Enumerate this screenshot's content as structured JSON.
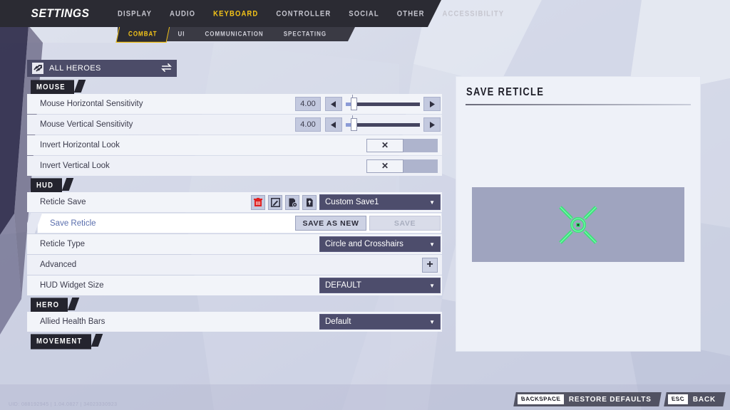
{
  "app": {
    "title": "SETTINGS"
  },
  "nav": {
    "tabs": [
      {
        "label": "DISPLAY",
        "active": false
      },
      {
        "label": "AUDIO",
        "active": false
      },
      {
        "label": "KEYBOARD",
        "active": true
      },
      {
        "label": "CONTROLLER",
        "active": false
      },
      {
        "label": "SOCIAL",
        "active": false
      },
      {
        "label": "OTHER",
        "active": false
      },
      {
        "label": "ACCESSIBILITY",
        "active": false
      }
    ],
    "subtabs": [
      {
        "label": "COMBAT",
        "active": true
      },
      {
        "label": "UI",
        "active": false
      },
      {
        "label": "COMMUNICATION",
        "active": false
      },
      {
        "label": "SPECTATING",
        "active": false
      }
    ]
  },
  "hero_selector": {
    "icon": "hero-roster-icon",
    "label": "ALL HEROES",
    "swap_icon": "swap-arrows-icon"
  },
  "sections": [
    {
      "title": "MOUSE",
      "rows": [
        {
          "label": "Mouse Horizontal Sensitivity",
          "control": "slider",
          "value": "4.00",
          "dec_icon": "left-arrow-icon",
          "inc_icon": "right-arrow-icon",
          "fill_percent": 8
        },
        {
          "label": "Mouse Vertical Sensitivity",
          "control": "slider",
          "value": "4.00",
          "dec_icon": "left-arrow-icon",
          "inc_icon": "right-arrow-icon",
          "fill_percent": 8
        },
        {
          "label": "Invert Horizontal Look",
          "control": "toggle",
          "value": "✕"
        },
        {
          "label": "Invert Vertical Look",
          "control": "toggle",
          "value": "✕"
        }
      ]
    },
    {
      "title": "HUD",
      "rows": [
        {
          "label": "Reticle Save",
          "control": "save-slot",
          "value": "Custom Save1",
          "caret": "▼",
          "icons": [
            {
              "name": "delete-icon",
              "glyph": "delete"
            },
            {
              "name": "rename-icon",
              "glyph": "rename"
            },
            {
              "name": "import-icon",
              "glyph": "import"
            },
            {
              "name": "export-icon",
              "glyph": "export"
            }
          ]
        },
        {
          "label": "Save Reticle",
          "control": "save-buttons",
          "selected": true,
          "primary_label": "SAVE AS NEW",
          "secondary_label": "SAVE",
          "secondary_disabled": true
        },
        {
          "label": "Reticle Type",
          "control": "dropdown",
          "value": "Circle and Crosshairs",
          "caret": "▼"
        },
        {
          "label": "Advanced",
          "control": "expand",
          "value": "+"
        },
        {
          "label": "HUD Widget Size",
          "control": "dropdown",
          "value": "DEFAULT",
          "caret": "▼"
        }
      ]
    },
    {
      "title": "HERO",
      "rows": [
        {
          "label": "Allied Health Bars",
          "control": "dropdown",
          "value": "Default",
          "caret": "▼"
        }
      ]
    },
    {
      "title": "MOVEMENT",
      "rows": []
    }
  ],
  "preview": {
    "title": "SAVE RETICLE",
    "reticle": {
      "name": "crosshair-preview",
      "color": "#3fe07a",
      "style": "Circle and Crosshairs"
    }
  },
  "bottom_bar": {
    "hints": [
      {
        "key": "BACKSPACE",
        "label": "RESTORE DEFAULTS"
      },
      {
        "key": "ESC",
        "label": "BACK"
      }
    ],
    "build_info": "UID: 088192945 | 1.04.0827 | 34023330923"
  },
  "colors": {
    "accent_yellow": "#f5c518",
    "reticle_green": "#3fe07a",
    "dropdown_slate": "#4d4d6c",
    "panel_light": "#f2f4f9",
    "bar_dark": "#24242e"
  }
}
